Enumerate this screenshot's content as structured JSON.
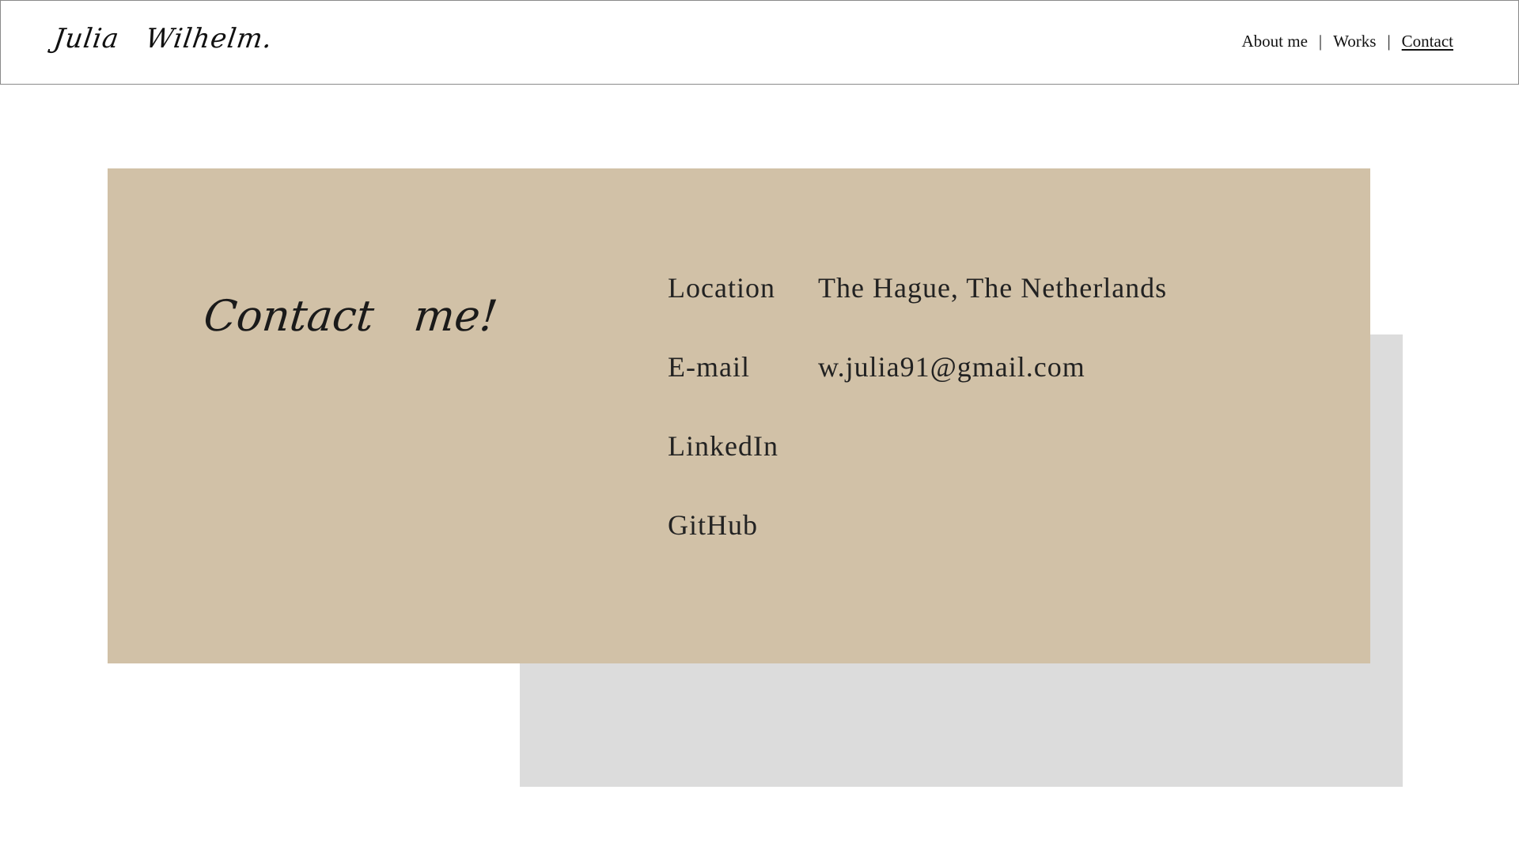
{
  "header": {
    "logo": "Julia Wilhelm.",
    "nav": [
      {
        "label": "About me",
        "active": false
      },
      {
        "label": "Works",
        "active": false
      },
      {
        "label": "Contact",
        "active": true
      }
    ],
    "separator": "|"
  },
  "main": {
    "heading": "Contact me!",
    "rows": [
      {
        "label": "Location",
        "value": "The Hague, The Netherlands"
      },
      {
        "label": "E-mail",
        "value": "w.julia91@gmail.com"
      },
      {
        "label": "LinkedIn",
        "value": ""
      },
      {
        "label": "GitHub",
        "value": ""
      }
    ]
  },
  "colors": {
    "card": "#d1c1a7",
    "shadow_block": "#dcdcdc",
    "border": "#8a8a8a",
    "text": "#1f1f1f"
  }
}
